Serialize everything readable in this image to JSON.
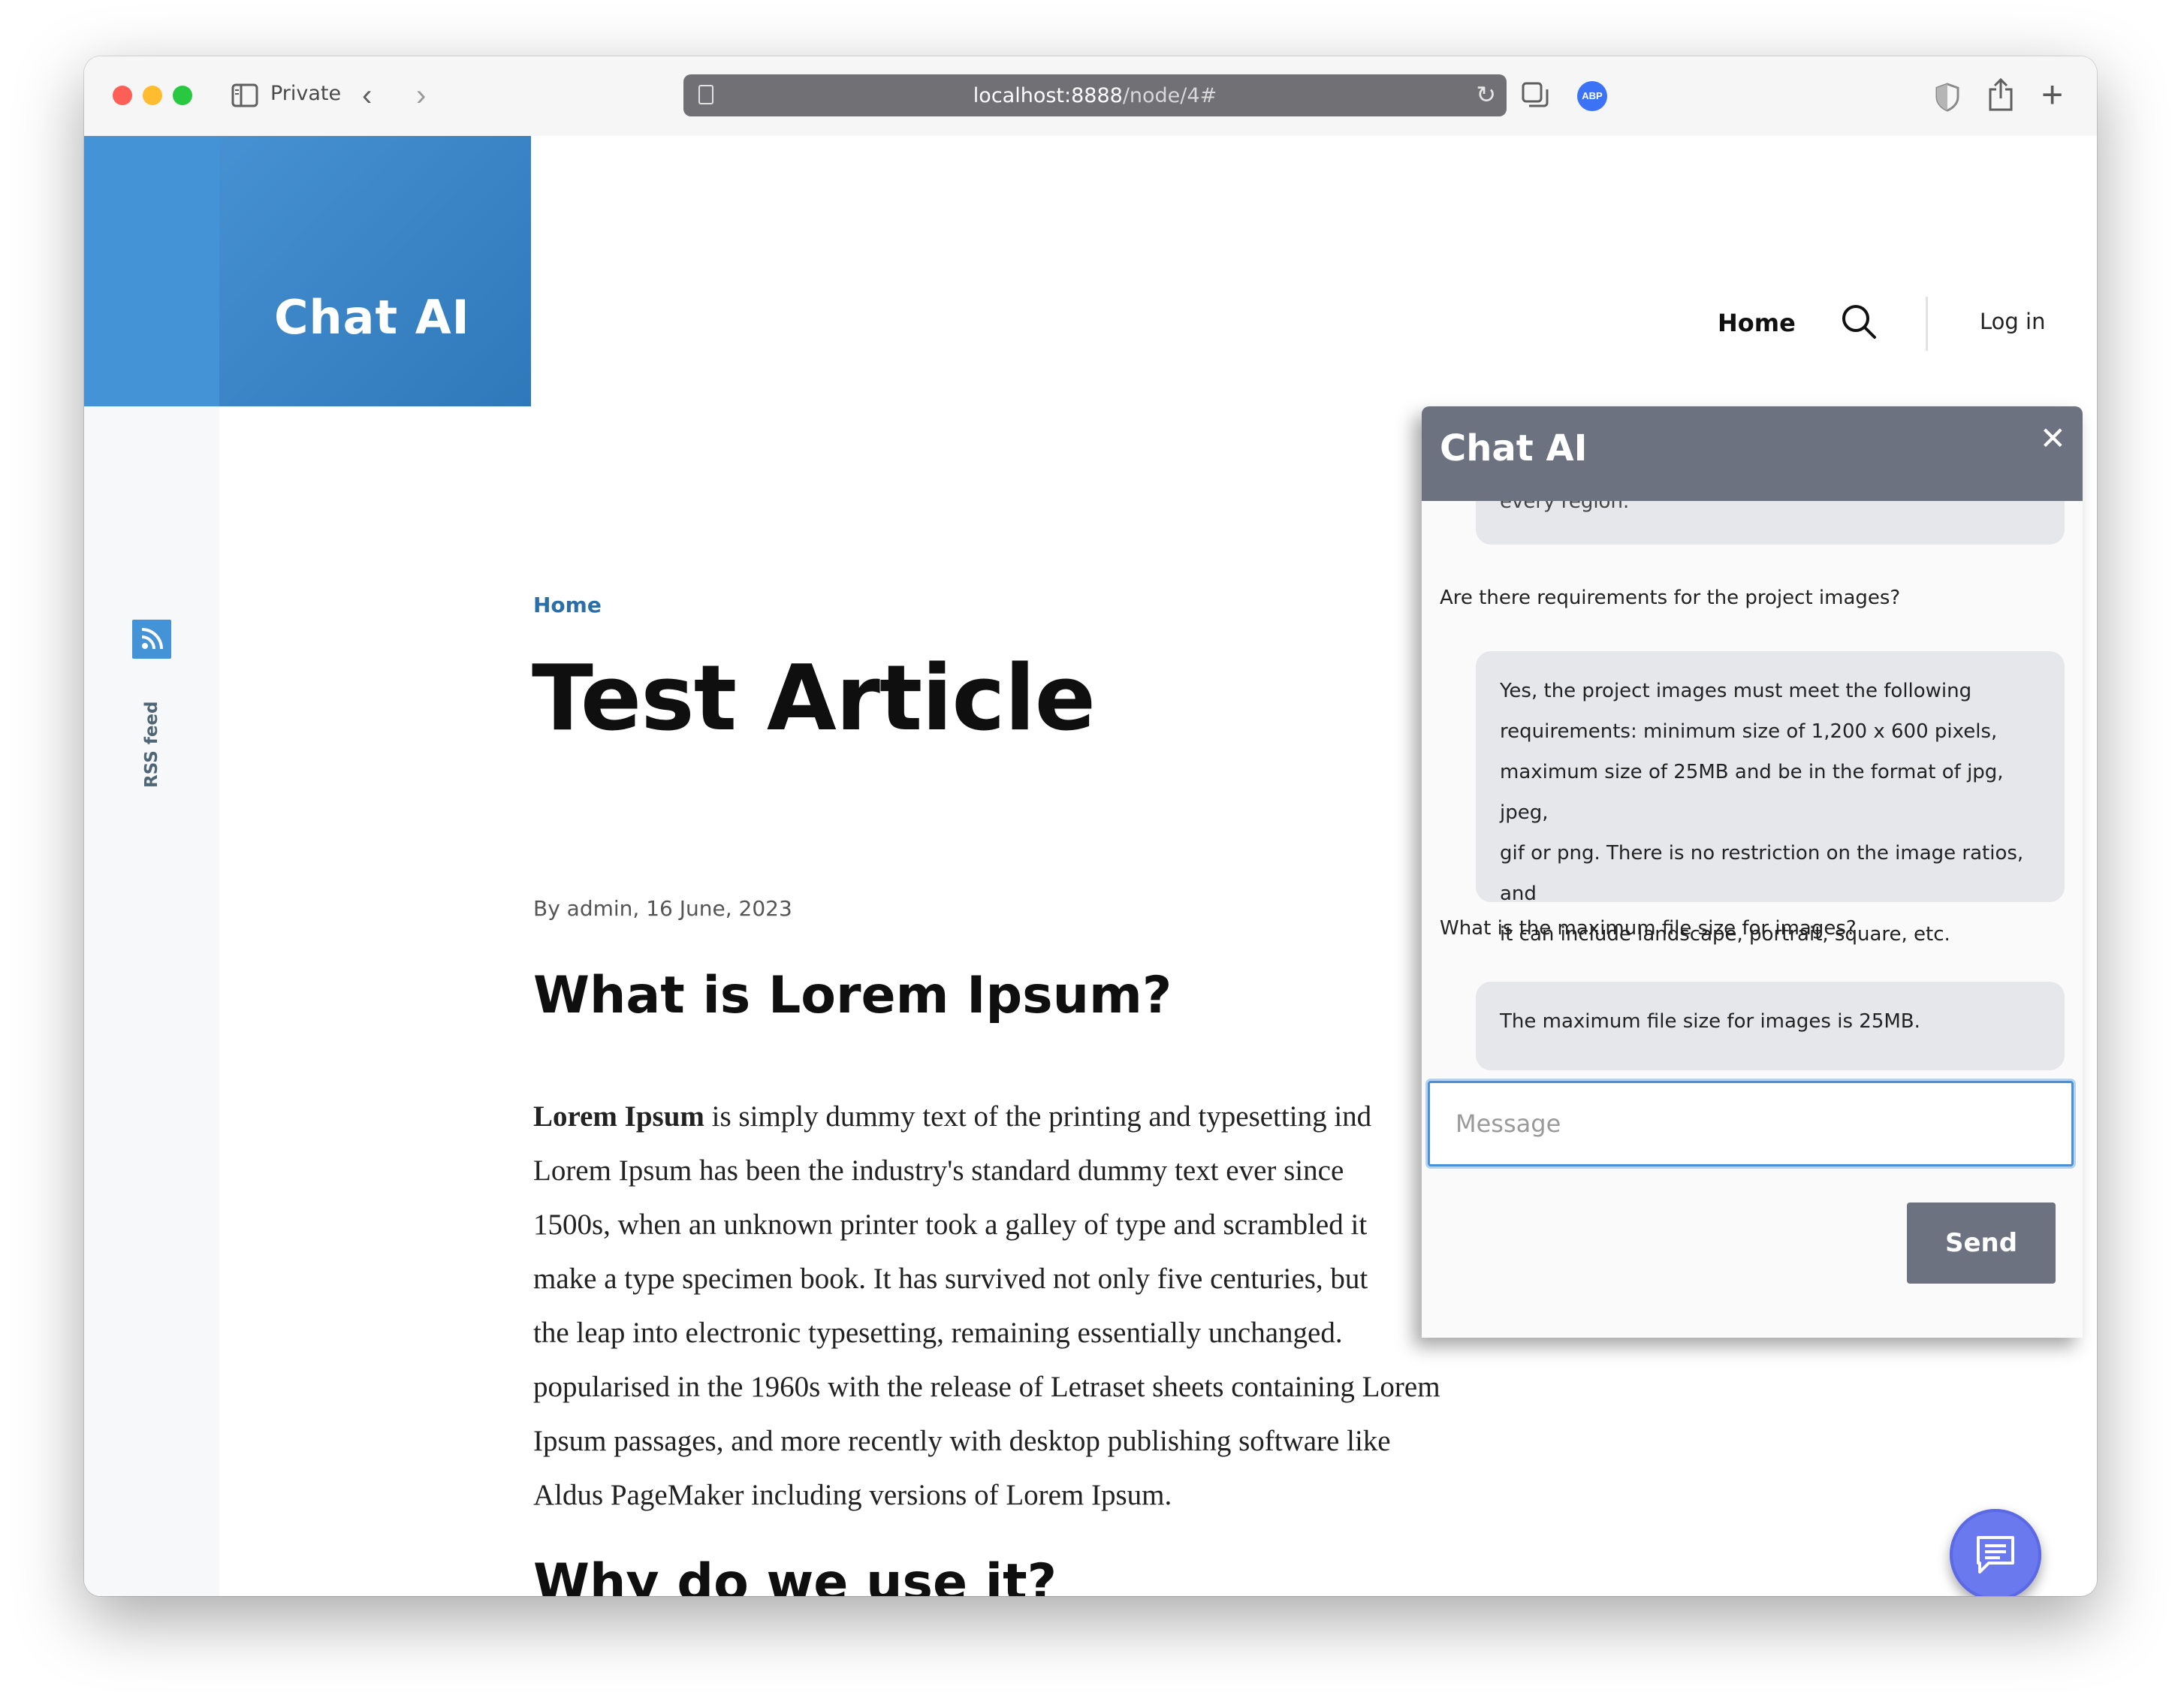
{
  "browser": {
    "private_label": "Private",
    "url_host": "localhost:8888",
    "url_path": "/node/4#",
    "extension_badge": "ABP"
  },
  "site": {
    "name": "Chat AI",
    "nav": {
      "home": "Home",
      "login": "Log in"
    },
    "rss_label": "RSS feed",
    "brand_color": "#3a86c8"
  },
  "article": {
    "breadcrumb": "Home",
    "title": "Test Article",
    "byline": "By admin, 16 June, 2023",
    "heading1": "What is Lorem Ipsum?",
    "paragraph_lead": "Lorem Ipsum",
    "paragraph_lines": [
      " is simply dummy text of the printing and typesetting ind",
      "Lorem Ipsum has been the industry's standard dummy text ever since",
      "1500s, when an unknown printer took a galley of type and scrambled it",
      "make a type specimen book. It has survived not only five centuries, but",
      "the leap into electronic typesetting, remaining essentially unchanged.",
      "popularised in the 1960s with the release of Letraset sheets containing Lorem",
      "Ipsum passages, and more recently with desktop publishing software like",
      "Aldus PageMaker including versions of Lorem Ipsum."
    ],
    "heading2": "Why do we use it?"
  },
  "chat": {
    "title": "Chat AI",
    "close_glyph": "✕",
    "messages": [
      {
        "role": "assistant",
        "text": "every region."
      },
      {
        "role": "user",
        "text": "Are there requirements for the project images?"
      },
      {
        "role": "assistant",
        "lines": [
          "Yes, the project images must meet the following",
          "requirements: minimum size of 1,200 x 600 pixels,",
          "maximum size of 25MB and be in the format of jpg, jpeg,",
          "gif or png. There is no restriction on the image ratios, and",
          "it can include landscape, portrait, square, etc."
        ]
      },
      {
        "role": "user",
        "text": "What is the maximum file size for images?"
      },
      {
        "role": "assistant",
        "text": "The maximum file size for images is 25MB."
      }
    ],
    "input_placeholder": "Message",
    "send_label": "Send",
    "header_color": "#6c7280",
    "fab_color": "#6a79ee"
  },
  "icons": {
    "sidebar": "sidebar-icon",
    "back": "chevron-left-icon",
    "forward": "chevron-right-icon",
    "reload": "reload-icon",
    "tabs": "tabs-icon",
    "privacy": "shield-icon",
    "share": "share-icon",
    "new_tab": "plus-icon",
    "search": "search-icon",
    "rss": "rss-icon",
    "chat_fab": "chat-bubble-icon"
  }
}
